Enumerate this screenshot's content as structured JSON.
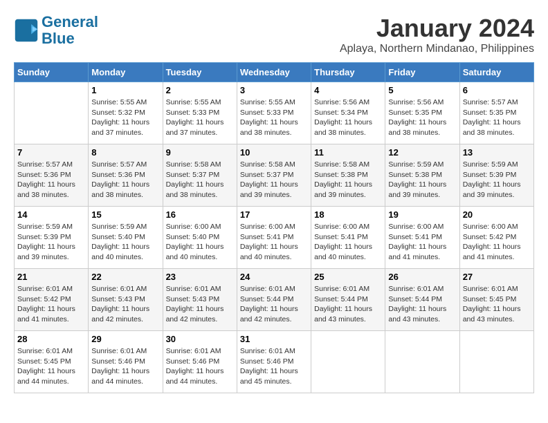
{
  "header": {
    "logo_line1": "General",
    "logo_line2": "Blue",
    "month_year": "January 2024",
    "location": "Aplaya, Northern Mindanao, Philippines"
  },
  "days_of_week": [
    "Sunday",
    "Monday",
    "Tuesday",
    "Wednesday",
    "Thursday",
    "Friday",
    "Saturday"
  ],
  "weeks": [
    [
      {
        "day": "",
        "info": ""
      },
      {
        "day": "1",
        "info": "Sunrise: 5:55 AM\nSunset: 5:32 PM\nDaylight: 11 hours\nand 37 minutes."
      },
      {
        "day": "2",
        "info": "Sunrise: 5:55 AM\nSunset: 5:33 PM\nDaylight: 11 hours\nand 37 minutes."
      },
      {
        "day": "3",
        "info": "Sunrise: 5:55 AM\nSunset: 5:33 PM\nDaylight: 11 hours\nand 38 minutes."
      },
      {
        "day": "4",
        "info": "Sunrise: 5:56 AM\nSunset: 5:34 PM\nDaylight: 11 hours\nand 38 minutes."
      },
      {
        "day": "5",
        "info": "Sunrise: 5:56 AM\nSunset: 5:35 PM\nDaylight: 11 hours\nand 38 minutes."
      },
      {
        "day": "6",
        "info": "Sunrise: 5:57 AM\nSunset: 5:35 PM\nDaylight: 11 hours\nand 38 minutes."
      }
    ],
    [
      {
        "day": "7",
        "info": "Sunrise: 5:57 AM\nSunset: 5:36 PM\nDaylight: 11 hours\nand 38 minutes."
      },
      {
        "day": "8",
        "info": "Sunrise: 5:57 AM\nSunset: 5:36 PM\nDaylight: 11 hours\nand 38 minutes."
      },
      {
        "day": "9",
        "info": "Sunrise: 5:58 AM\nSunset: 5:37 PM\nDaylight: 11 hours\nand 38 minutes."
      },
      {
        "day": "10",
        "info": "Sunrise: 5:58 AM\nSunset: 5:37 PM\nDaylight: 11 hours\nand 39 minutes."
      },
      {
        "day": "11",
        "info": "Sunrise: 5:58 AM\nSunset: 5:38 PM\nDaylight: 11 hours\nand 39 minutes."
      },
      {
        "day": "12",
        "info": "Sunrise: 5:59 AM\nSunset: 5:38 PM\nDaylight: 11 hours\nand 39 minutes."
      },
      {
        "day": "13",
        "info": "Sunrise: 5:59 AM\nSunset: 5:39 PM\nDaylight: 11 hours\nand 39 minutes."
      }
    ],
    [
      {
        "day": "14",
        "info": "Sunrise: 5:59 AM\nSunset: 5:39 PM\nDaylight: 11 hours\nand 39 minutes."
      },
      {
        "day": "15",
        "info": "Sunrise: 5:59 AM\nSunset: 5:40 PM\nDaylight: 11 hours\nand 40 minutes."
      },
      {
        "day": "16",
        "info": "Sunrise: 6:00 AM\nSunset: 5:40 PM\nDaylight: 11 hours\nand 40 minutes."
      },
      {
        "day": "17",
        "info": "Sunrise: 6:00 AM\nSunset: 5:41 PM\nDaylight: 11 hours\nand 40 minutes."
      },
      {
        "day": "18",
        "info": "Sunrise: 6:00 AM\nSunset: 5:41 PM\nDaylight: 11 hours\nand 40 minutes."
      },
      {
        "day": "19",
        "info": "Sunrise: 6:00 AM\nSunset: 5:41 PM\nDaylight: 11 hours\nand 41 minutes."
      },
      {
        "day": "20",
        "info": "Sunrise: 6:00 AM\nSunset: 5:42 PM\nDaylight: 11 hours\nand 41 minutes."
      }
    ],
    [
      {
        "day": "21",
        "info": "Sunrise: 6:01 AM\nSunset: 5:42 PM\nDaylight: 11 hours\nand 41 minutes."
      },
      {
        "day": "22",
        "info": "Sunrise: 6:01 AM\nSunset: 5:43 PM\nDaylight: 11 hours\nand 42 minutes."
      },
      {
        "day": "23",
        "info": "Sunrise: 6:01 AM\nSunset: 5:43 PM\nDaylight: 11 hours\nand 42 minutes."
      },
      {
        "day": "24",
        "info": "Sunrise: 6:01 AM\nSunset: 5:44 PM\nDaylight: 11 hours\nand 42 minutes."
      },
      {
        "day": "25",
        "info": "Sunrise: 6:01 AM\nSunset: 5:44 PM\nDaylight: 11 hours\nand 43 minutes."
      },
      {
        "day": "26",
        "info": "Sunrise: 6:01 AM\nSunset: 5:44 PM\nDaylight: 11 hours\nand 43 minutes."
      },
      {
        "day": "27",
        "info": "Sunrise: 6:01 AM\nSunset: 5:45 PM\nDaylight: 11 hours\nand 43 minutes."
      }
    ],
    [
      {
        "day": "28",
        "info": "Sunrise: 6:01 AM\nSunset: 5:45 PM\nDaylight: 11 hours\nand 44 minutes."
      },
      {
        "day": "29",
        "info": "Sunrise: 6:01 AM\nSunset: 5:46 PM\nDaylight: 11 hours\nand 44 minutes."
      },
      {
        "day": "30",
        "info": "Sunrise: 6:01 AM\nSunset: 5:46 PM\nDaylight: 11 hours\nand 44 minutes."
      },
      {
        "day": "31",
        "info": "Sunrise: 6:01 AM\nSunset: 5:46 PM\nDaylight: 11 hours\nand 45 minutes."
      },
      {
        "day": "",
        "info": ""
      },
      {
        "day": "",
        "info": ""
      },
      {
        "day": "",
        "info": ""
      }
    ]
  ]
}
